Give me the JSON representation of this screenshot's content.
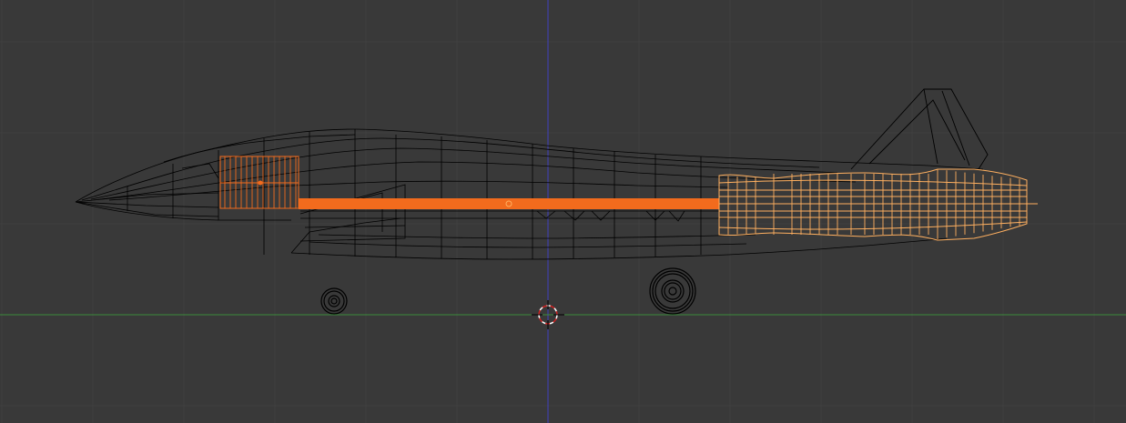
{
  "viewport": {
    "view": "side-orthographic",
    "shading": "wireframe",
    "background_color": "#393939",
    "grid_color": "#404040",
    "x_axis_color": "#3b8c3b",
    "z_axis_color": "#4040c0",
    "wire_color": "#000000",
    "selected_color": "#f26b1d",
    "active_color": "#ffb060"
  },
  "scene": {
    "objects": [
      {
        "name": "fuselage",
        "selected": false
      },
      {
        "name": "tail-fin",
        "selected": false
      },
      {
        "name": "intake",
        "selected": true
      },
      {
        "name": "engine-shaft",
        "selected": true
      },
      {
        "name": "engine-nozzle",
        "selected": true,
        "active": true
      },
      {
        "name": "front-wheel",
        "selected": false
      },
      {
        "name": "rear-wheel",
        "selected": false
      }
    ]
  },
  "cursor": {
    "icon": "3d-cursor-icon"
  }
}
